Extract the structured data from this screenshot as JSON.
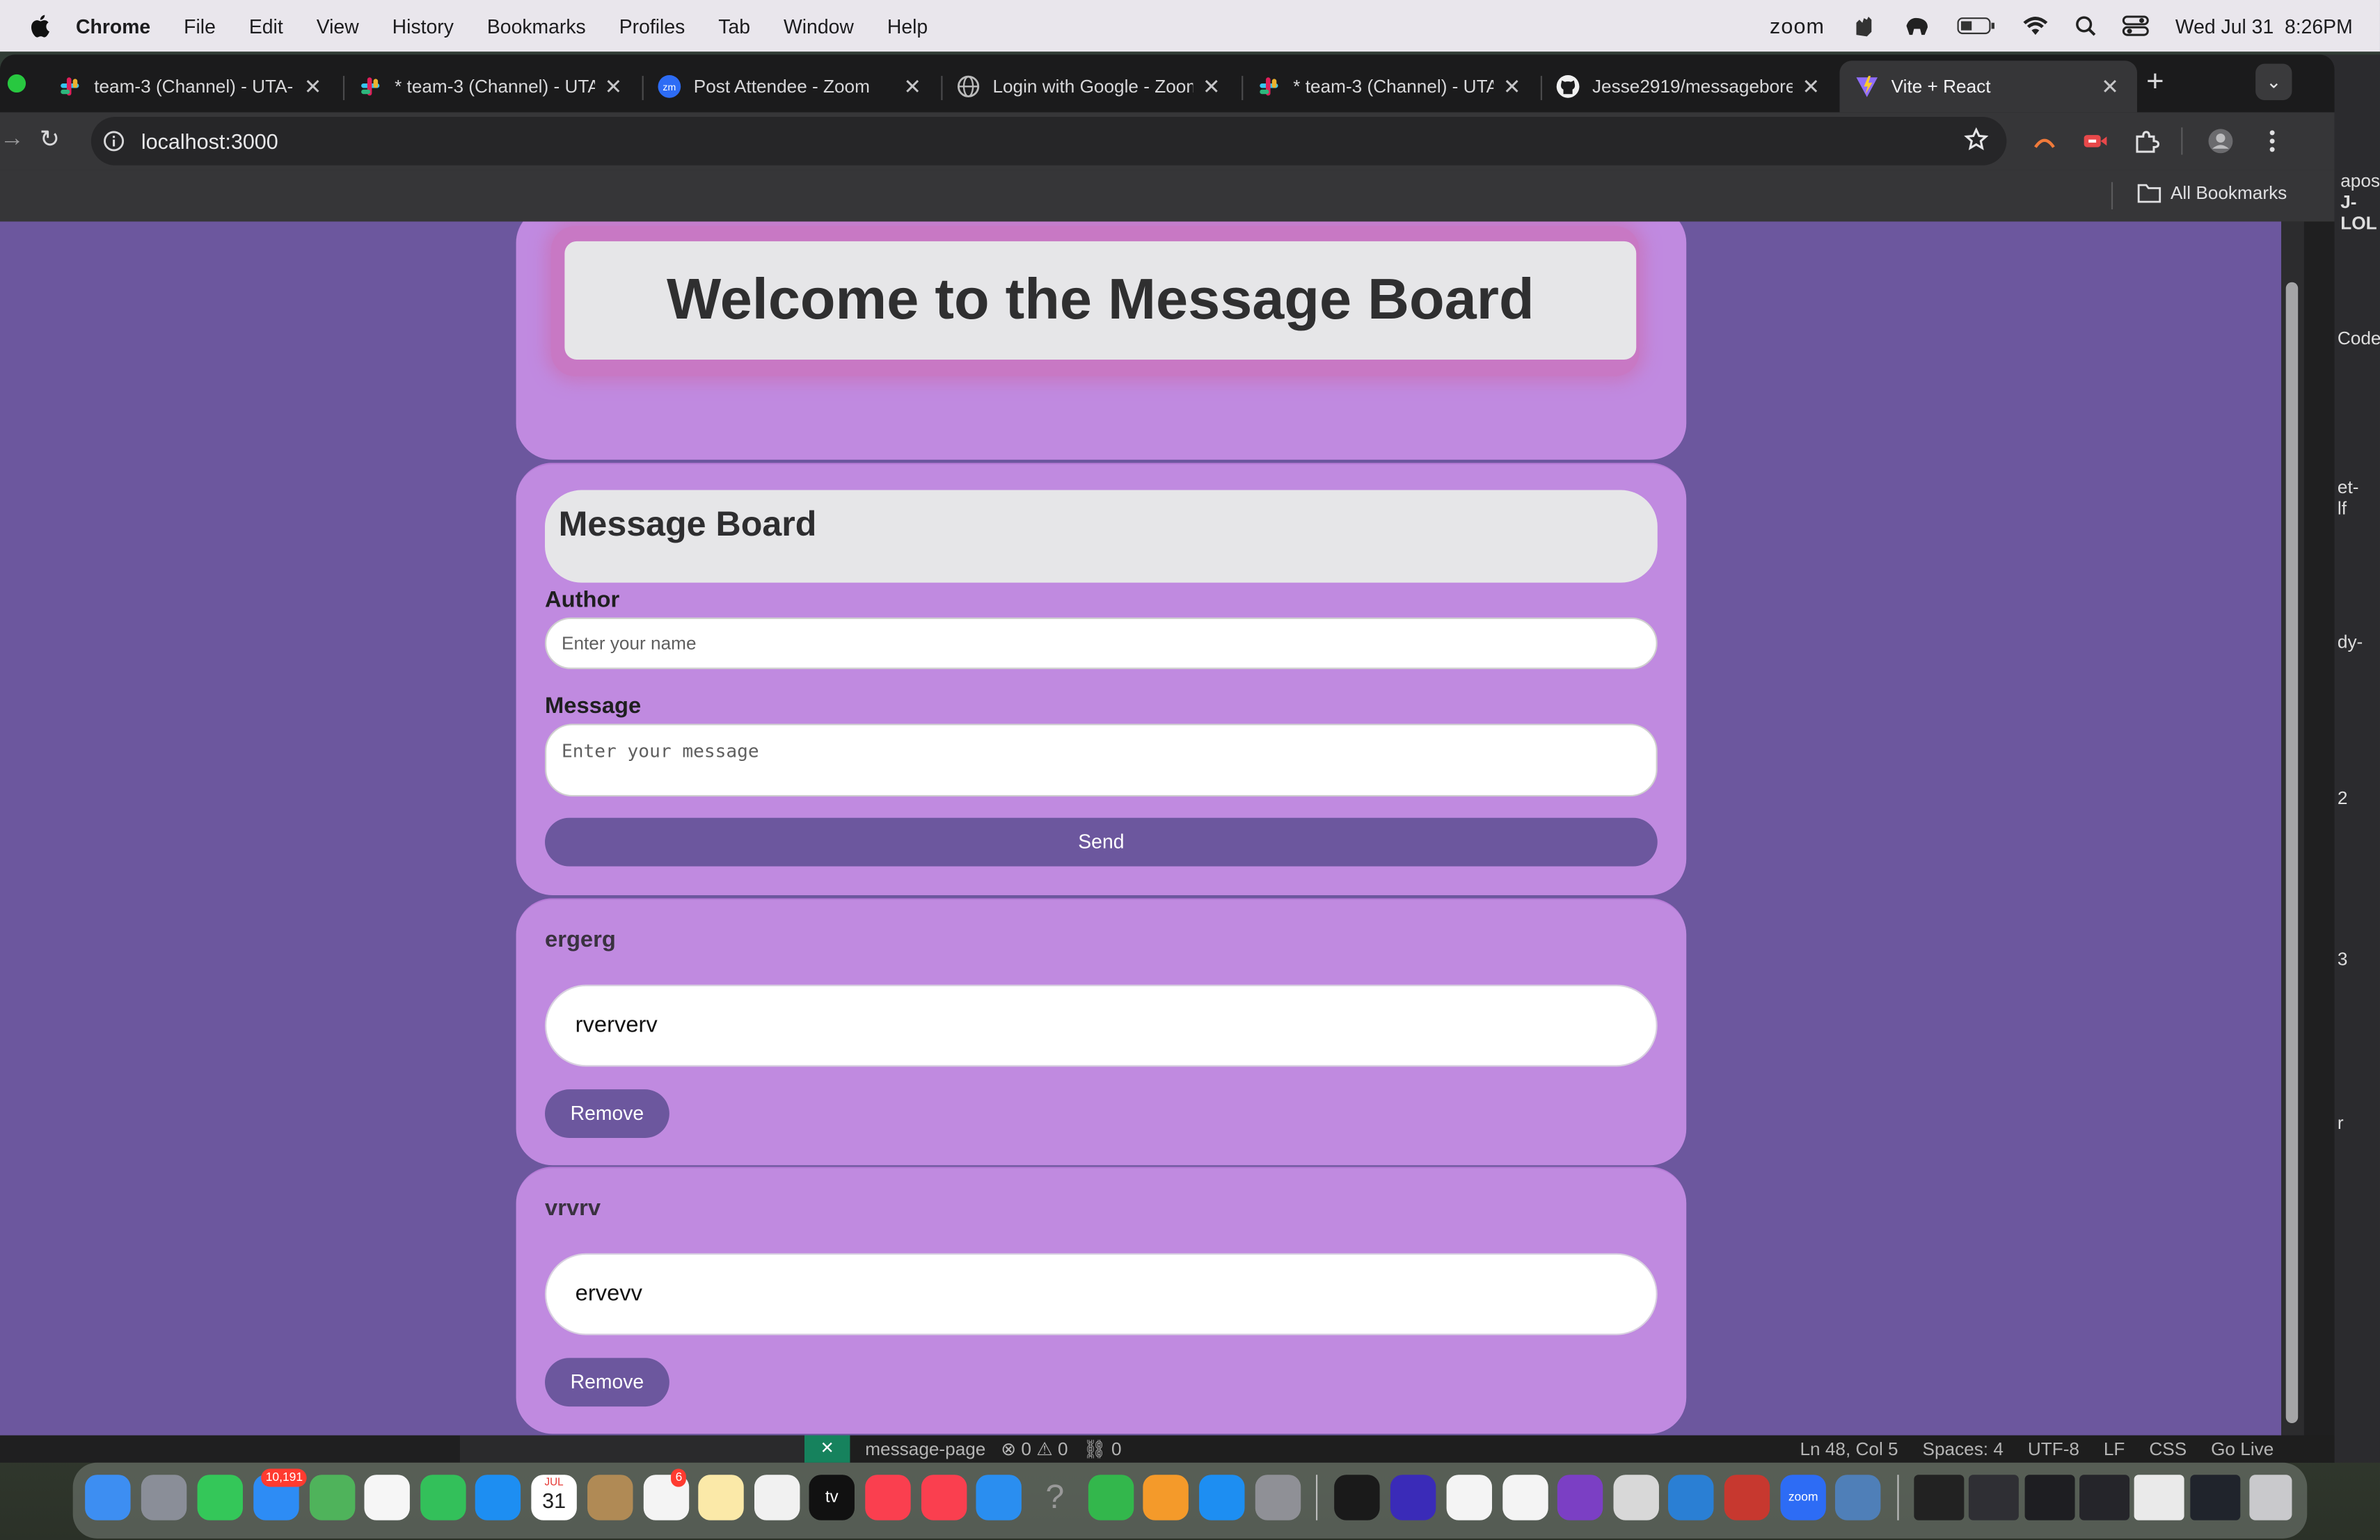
{
  "menubar": {
    "app_name": "Chrome",
    "menus": [
      "File",
      "Edit",
      "View",
      "History",
      "Bookmarks",
      "Profiles",
      "Tab",
      "Window",
      "Help"
    ],
    "zoom_label": "zoom",
    "datetime": "Wed Jul 31  8:26PM"
  },
  "browser": {
    "tabs": [
      {
        "label": "team-3 (Channel) - UTA-",
        "icon": "slack-icon"
      },
      {
        "label": "* team-3 (Channel) - UTA",
        "icon": "slack-icon"
      },
      {
        "label": "Post Attendee - Zoom",
        "icon": "zoom-icon"
      },
      {
        "label": "Login with Google - Zoom",
        "icon": "globe-icon"
      },
      {
        "label": "* team-3 (Channel) - UTA",
        "icon": "slack-icon"
      },
      {
        "label": "Jesse2919/messagebore",
        "icon": "github-icon"
      },
      {
        "label": "Vite + React",
        "icon": "vite-icon",
        "active": true
      }
    ],
    "url": "localhost:3000",
    "bookmarks_label": "All Bookmarks"
  },
  "page": {
    "welcome_title": "Welcome to the Message Board",
    "board_title": "Message Board",
    "form": {
      "author_label": "Author",
      "author_placeholder": "Enter your name",
      "message_label": "Message",
      "message_placeholder": "Enter your message",
      "send_label": "Send"
    },
    "messages": [
      {
        "author": "ergerg",
        "text": "rververv",
        "remove_label": "Remove"
      },
      {
        "author": "vrvrv",
        "text": "ervevv",
        "remove_label": "Remove"
      }
    ]
  },
  "vscode_status": {
    "branch": "message-page",
    "problems": "0",
    "warnings": "0",
    "ports": "0",
    "cursor": "Ln 48, Col 5",
    "spaces": "Spaces: 4",
    "encoding": "UTF-8",
    "eol": "LF",
    "language": "CSS",
    "golive": "Go Live"
  },
  "behind_window_text": [
    "apose",
    "J-LOL",
    "Code",
    "et-",
    "lf",
    "dy-",
    "2",
    "3",
    "r"
  ],
  "dock": {
    "mail_badge": "10,191",
    "reminders_badge": "6",
    "calendar_month": "JUL",
    "calendar_day": "31",
    "zoom_label": "zoom",
    "tv_label": "tv"
  },
  "colors": {
    "page_bg": "#6c579e",
    "card_bg": "#c08ae0",
    "button_bg": "#6c579e",
    "heading_box": "#e6e6e8"
  }
}
